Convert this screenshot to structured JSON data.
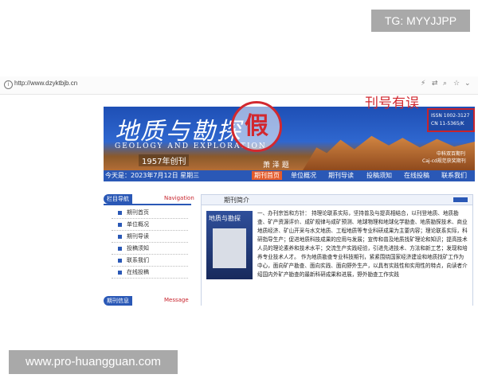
{
  "overlay": {
    "tg_label": "TG: MYYJJPP",
    "watermark": "www.pro-huangguan.com",
    "error_label": "刊号有误",
    "fake_stamp": "假"
  },
  "browser": {
    "url": "http://www.dzyktbjb.cn"
  },
  "banner": {
    "title": "地质与勘探",
    "subtitle_en": "GEOLOGY  AND  EXPLORATION",
    "founded": "1957年创刊",
    "signature": "萧 泽 题",
    "issn": "ISSN   1002-3127",
    "cn": "CN     11-5365/K",
    "mark1": "中科双百期刊",
    "mark2": "Caj-cd规范获奖期刊"
  },
  "navbar": {
    "date": "今天是：2023年7月12日 星期三",
    "items": [
      "期刊首页",
      "单位概况",
      "期刊导读",
      "投稿须知",
      "在线投稿",
      "联系我们"
    ]
  },
  "sidebar": {
    "title": "栏目导航",
    "title_en": "Navigation",
    "items": [
      "期刊首页",
      "单位概况",
      "期刊导读",
      "投稿须知",
      "联系我们",
      "在线投稿"
    ],
    "title2": "期刊信息",
    "title2_en": "Message"
  },
  "main": {
    "title": "期刊简介",
    "cover_title": "地质与勘探",
    "intro": "一、办刊宗旨和方针：        持理论联系实际，坚持普及与提高相结合，以刊登地质、地质勘查、矿产资源评价、成矿规律与成矿预测、地球物理和地球化学勘查、地质勘探技术、商业地质经济、矿山开采与水文地质、工程地质等专业科研成果为主要内容；理论联系实际，科研指导生产；促进地质科技成果的应用与发展；宣传和普及地质找矿理论和知识；提高技术人员的理论素养和技术水平；交流生产实践经验，引进先进技术、方法和新工艺；发现和培养专业技术人才。        作为地质勘查专业科技期刊，紧紧围绕国家经济建设和地质找矿工作为中心，面向矿产勘查、面向实践、面向野外生产，以具有实践性和实用性的特点，向读者介绍国内外矿产勘查的最新科研成果和进展，野外勘查工作实践"
  }
}
